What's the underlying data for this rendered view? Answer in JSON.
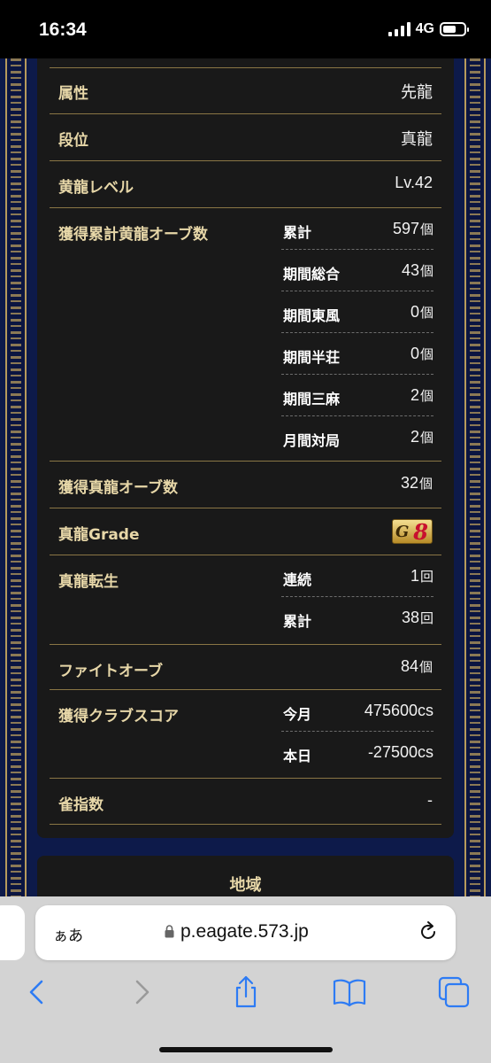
{
  "status_bar": {
    "time": "16:34",
    "network": "4G"
  },
  "profile": {
    "rows": [
      {
        "label": "属性",
        "value": "先龍"
      },
      {
        "label": "段位",
        "value": "真龍"
      },
      {
        "label": "黄龍レベル",
        "value": "Lv.42"
      }
    ],
    "orb_total": {
      "label": "獲得累計黄龍オーブ数",
      "items": [
        {
          "label": "累計",
          "value": "597",
          "unit": "個"
        },
        {
          "label": "期間総合",
          "value": "43",
          "unit": "個"
        },
        {
          "label": "期間東風",
          "value": "0",
          "unit": "個"
        },
        {
          "label": "期間半荘",
          "value": "0",
          "unit": "個"
        },
        {
          "label": "期間三麻",
          "value": "2",
          "unit": "個"
        },
        {
          "label": "月間対局",
          "value": "2",
          "unit": "個"
        }
      ]
    },
    "shinryu_orb": {
      "label": "獲得真龍オーブ数",
      "value": "32",
      "unit": "個"
    },
    "grade": {
      "label": "真龍Grade",
      "badge_letter": "G",
      "badge_number": "8"
    },
    "reincarnation": {
      "label": "真龍転生",
      "items": [
        {
          "label": "連続",
          "value": "1",
          "unit": "回"
        },
        {
          "label": "累計",
          "value": "38",
          "unit": "回"
        }
      ]
    },
    "fight_orb": {
      "label": "ファイトオーブ",
      "value": "84",
      "unit": "個"
    },
    "club_score": {
      "label": "獲得クラブスコア",
      "items": [
        {
          "label": "今月",
          "value": "475600cs"
        },
        {
          "label": "本日",
          "value": "-27500cs"
        }
      ]
    },
    "jan_shisu": {
      "label": "雀指数",
      "value": "-"
    }
  },
  "region": {
    "title": "地域"
  },
  "browser": {
    "aa_label": "ぁあ",
    "url": "p.eagate.573.jp",
    "icons": [
      "lock-icon",
      "reload-icon",
      "back-icon",
      "forward-icon",
      "share-icon",
      "bookmarks-icon",
      "tabs-icon"
    ]
  },
  "colors": {
    "gold_text": "#e7d7a8",
    "gold_line": "#8a7645",
    "panel_bg": "#191919",
    "page_bg": "#0d1a4a",
    "ios_blue": "#2d7bf4"
  }
}
